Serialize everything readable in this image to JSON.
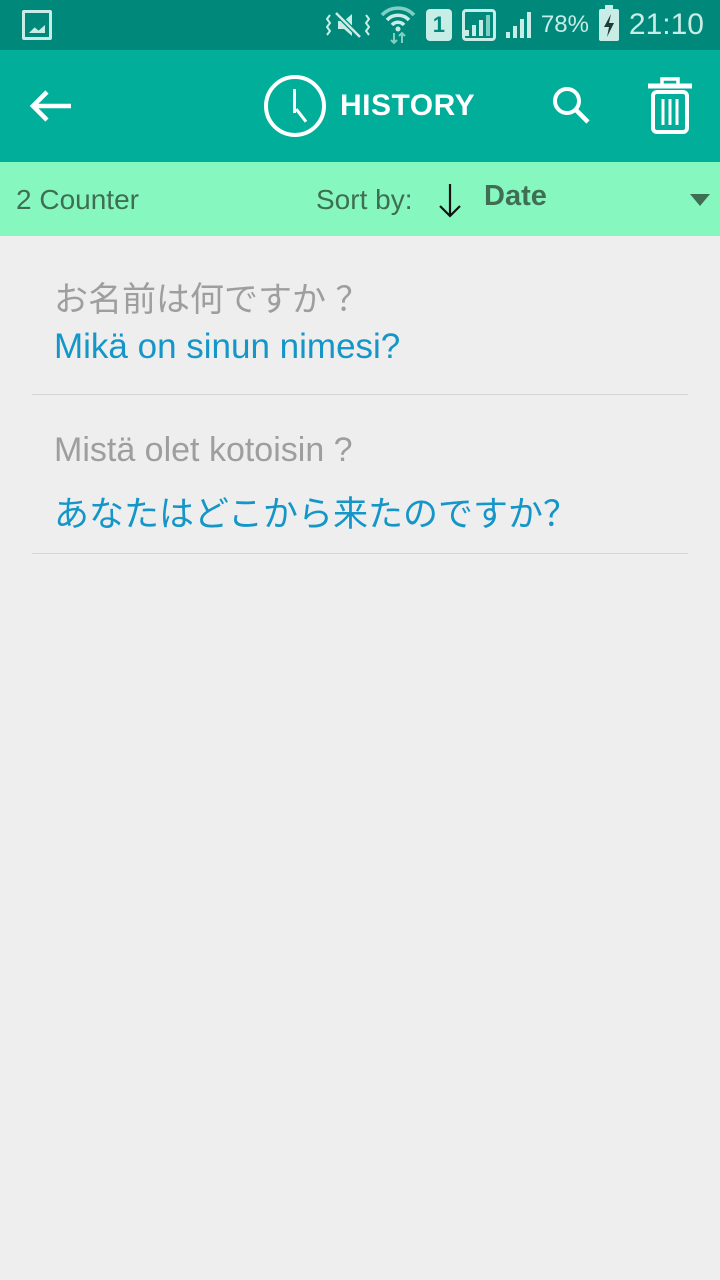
{
  "status_bar": {
    "battery_percent": "78%",
    "time": "21:10",
    "sim_slot": "1",
    "icons": [
      "image-notification-icon",
      "vibrate-mute-icon",
      "wifi-icon",
      "sim-1-icon",
      "signal-icon",
      "signal-icon",
      "battery-charging-icon"
    ]
  },
  "app_bar": {
    "title": "HISTORY",
    "back_icon": "arrow-left-icon",
    "title_icon": "clock-icon",
    "search_icon": "search-icon",
    "delete_icon": "trash-icon"
  },
  "sort_bar": {
    "counter": "2 Counter",
    "sort_label": "Sort by:",
    "sort_direction": "descending",
    "sort_value": "Date"
  },
  "history": [
    {
      "source": "お名前は何ですか ？",
      "translation": "Mikä on sinun nimesi?"
    },
    {
      "source": "Mistä olet kotoisin ?",
      "translation": "あなたはどこから来たのですか？"
    }
  ],
  "colors": {
    "status_bar": "#00897b",
    "app_bar": "#00ae9a",
    "sort_bar": "#86f8bf",
    "source_text": "#9e9e9e",
    "translation_text": "#1496c8",
    "background": "#eeeeee"
  }
}
